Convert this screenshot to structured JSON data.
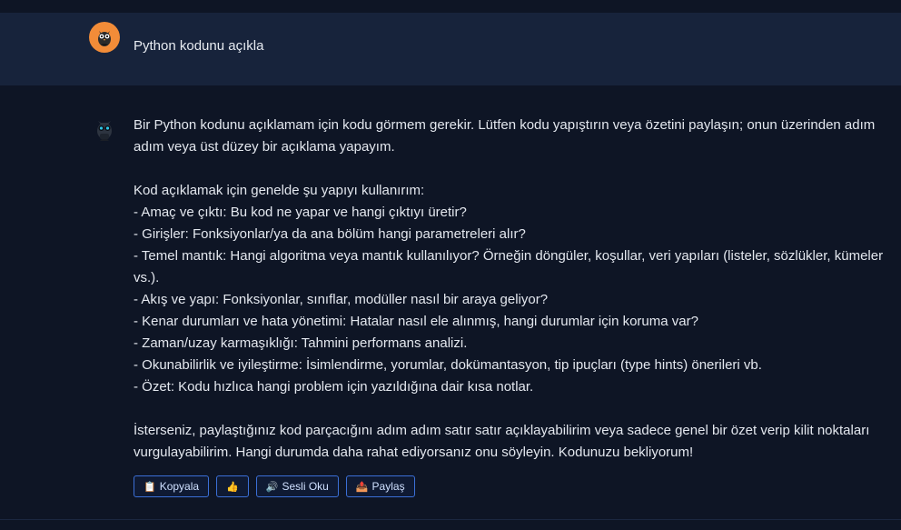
{
  "conversation": {
    "user_message": "Python kodunu açıkla",
    "assistant_paragraphs": [
      "Bir Python kodunu açıklamam için kodu görmem gerekir. Lütfen kodu yapıştırın veya özetini paylaşın; onun üzerinden adım adım veya üst düzey bir açıklama yapayım.",
      "",
      "Kod açıklamak için genelde şu yapıyı kullanırım:",
      "- Amaç ve çıktı: Bu kod ne yapar ve hangi çıktıyı üretir?",
      "- Girişler: Fonksiyonlar/ya da ana bölüm hangi parametreleri alır?",
      "- Temel mantık: Hangi algoritma veya mantık kullanılıyor? Örneğin döngüler, koşullar, veri yapıları (listeler, sözlükler, kümeler vs.).",
      "- Akış ve yapı: Fonksiyonlar, sınıflar, modüller nasıl bir araya geliyor?",
      "- Kenar durumları ve hata yönetimi: Hatalar nasıl ele alınmış, hangi durumlar için koruma var?",
      "- Zaman/uzay karmaşıklığı: Tahmini performans analizi.",
      "- Okunabilirlik ve iyileştirme: İsimlendirme, yorumlar, dokümantasyon, tip ipuçları (type hints) önerileri vb.",
      "- Özet: Kodu hızlıca hangi problem için yazıldığına dair kısa notlar.",
      "",
      "İsterseniz, paylaştığınız kod parçacığını adım adım satır satır açıklayabilirim veya sadece genel bir özet verip kilit noktaları vurgulayabilirim. Hangi durumda daha rahat ediyorsanız onu söyleyin. Kodunuzu bekliyorum!"
    ]
  },
  "actions": {
    "copy": {
      "label": "Kopyala",
      "icon": "clipboard-icon"
    },
    "like": {
      "label": "",
      "icon": "thumbs-up-icon"
    },
    "read_aloud": {
      "label": "Sesli Oku",
      "icon": "speaker-icon"
    },
    "share": {
      "label": "Paylaş",
      "icon": "share-icon"
    }
  },
  "colors": {
    "background": "#0e1525",
    "user_row": "#17233b",
    "user_avatar": "#f28c38",
    "button_border": "#3b6fd6"
  }
}
